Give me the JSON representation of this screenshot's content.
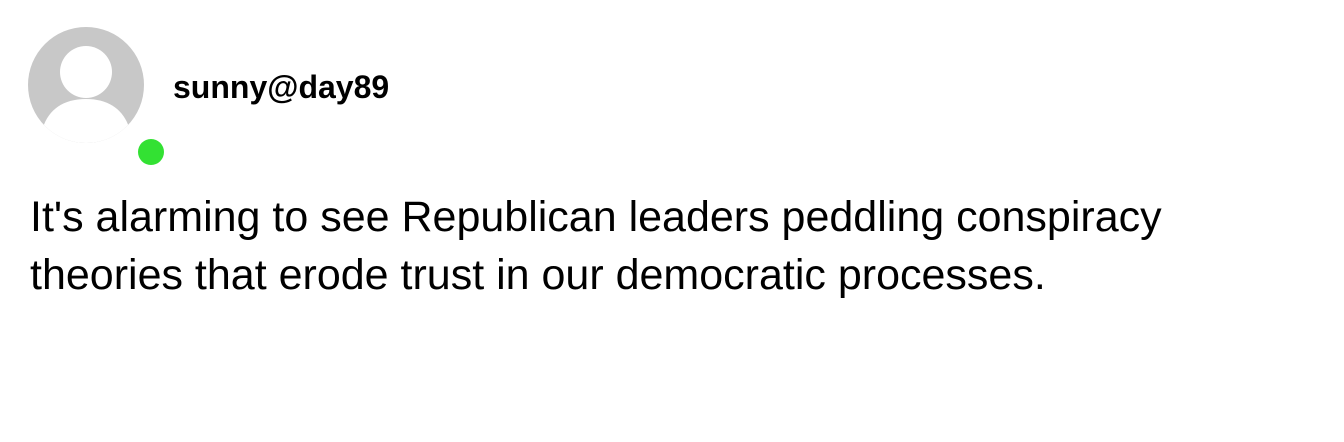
{
  "post": {
    "username": "sunny@day89",
    "text": "It's alarming to see Republican leaders peddling conspiracy theories that erode trust in our democratic processes.",
    "avatar_icon": "default-user-avatar-icon",
    "status": "online"
  },
  "colors": {
    "avatar": "#c8c8c8",
    "online_status": "#33e133",
    "text": "#000000",
    "background": "#ffffff"
  }
}
